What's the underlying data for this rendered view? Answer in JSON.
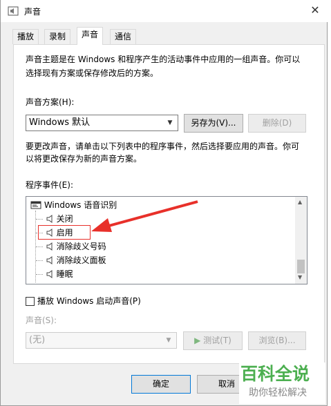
{
  "window": {
    "title": "声音",
    "close_glyph": "✕"
  },
  "tabs": [
    {
      "label": "播放"
    },
    {
      "label": "录制"
    },
    {
      "label": "声音"
    },
    {
      "label": "通信"
    }
  ],
  "description": {
    "line1": "声音主题是在 Windows 和程序产生的活动事件中应用的一组声音。你可以",
    "line2": "选择现有方案或保存修改后的方案。"
  },
  "scheme": {
    "label": "声音方案(H):",
    "selected": "Windows 默认",
    "save_as_label": "另存为(V)...",
    "delete_label": "删除(D)"
  },
  "instructions": {
    "line1": "要更改声音，请单击以下列表中的程序事件，然后选择要应用的声音。你可",
    "line2": "以将更改保存为新的声音方案。"
  },
  "events": {
    "label": "程序事件(E):",
    "group": "Windows 语音识别",
    "items": [
      {
        "label": "关闭"
      },
      {
        "label": "启用"
      },
      {
        "label": "消除歧义号码"
      },
      {
        "label": "消除歧义面板"
      },
      {
        "label": "睡眠"
      }
    ]
  },
  "startup_sound": {
    "label": "播放 Windows 启动声音(P)",
    "checked": false
  },
  "sound": {
    "label": "声音(S):",
    "selected": "(无)",
    "test_label": "测试(T)",
    "browse_label": "浏览(B)..."
  },
  "footer": {
    "ok_label": "确定",
    "cancel_label": "取消"
  },
  "watermark": {
    "brand": "百科全说",
    "tagline": "助你轻松解决"
  },
  "colors": {
    "annotation_red": "#e8302a",
    "watermark_green": "#4caf50"
  }
}
